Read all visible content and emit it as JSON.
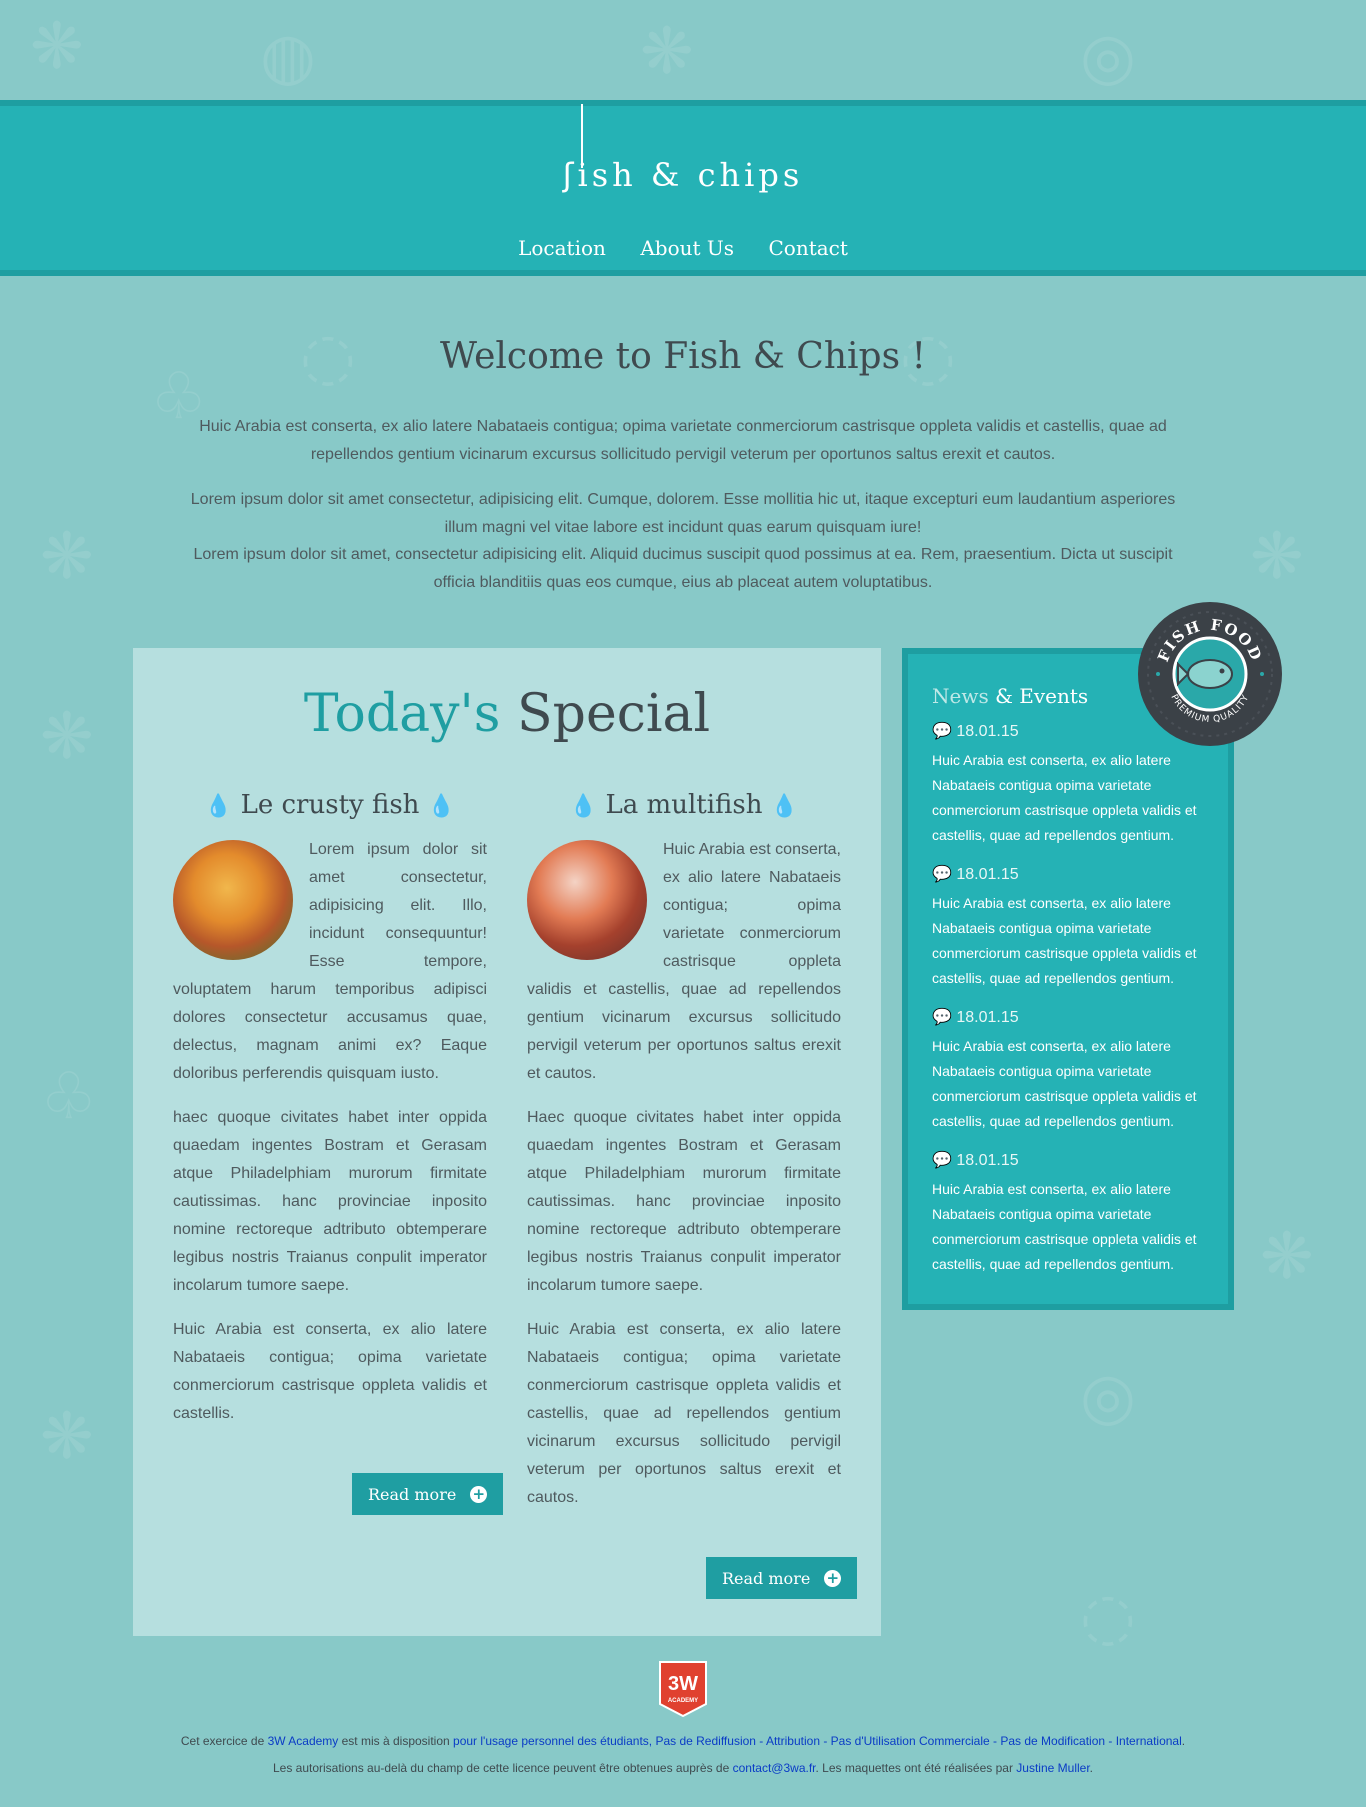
{
  "header": {
    "logo": "ish & chips",
    "nav": [
      "Location",
      "About Us",
      "Contact"
    ]
  },
  "welcome": {
    "title": "Welcome to Fish & Chips !",
    "para1": "Huic Arabia est conserta, ex alio latere Nabataeis contigua; opima varietate conmerciorum castrisque oppleta validis et castellis, quae ad repellendos gentium vicinarum excursus sollicitudo pervigil veterum per oportunos saltus erexit et cautos.",
    "para2": "Lorem ipsum dolor sit amet consectetur, adipisicing elit. Cumque, dolorem. Esse mollitia hic ut, itaque excepturi eum laudantium asperiores illum magni vel vitae labore est incidunt quas earum quisquam iure!",
    "para3": "Lorem ipsum dolor sit amet, consectetur adipisicing elit. Aliquid ducimus suscipit quod possimus at ea. Rem, praesentium. Dicta ut suscipit officia blanditiis quas eos cumque, eius ab placeat autem voluptatibus."
  },
  "special": {
    "title_accent": "Today's",
    "title_rest": "Special",
    "dishes": [
      {
        "name": "Le crusty fish",
        "p1": "Lorem ipsum dolor sit amet consectetur, adipisicing elit. Illo, incidunt consequuntur! Esse tempore, voluptatem harum temporibus adipisci dolores consectetur accusamus quae, delectus, magnam animi ex? Eaque doloribus perferendis quisquam iusto.",
        "p2": "haec quoque civitates habet inter oppida quaedam ingentes Bostram et Gerasam atque Philadelphiam murorum firmitate cautissimas. hanc provinciae inposito nomine rectoreque adtributo obtemperare legibus nostris Traianus conpulit imperator incolarum tumore saepe.",
        "p3": "Huic Arabia est conserta, ex alio latere Nabataeis contigua; opima varietate conmerciorum castrisque oppleta validis et castellis.",
        "button": "Read more"
      },
      {
        "name": "La multifish",
        "p1": "Huic Arabia est conserta, ex alio latere Nabataeis contigua; opima varietate conmerciorum castrisque oppleta validis et castellis, quae ad repellendos gentium vicinarum excursus sollicitudo pervigil veterum per oportunos saltus erexit et cautos.",
        "p2": "Haec quoque civitates habet inter oppida quaedam ingentes Bostram et Gerasam atque Philadelphiam murorum firmitate cautissimas. hanc provinciae inposito nomine rectoreque adtributo obtemperare legibus nostris Traianus conpulit imperator incolarum tumore saepe.",
        "p3": "Huic Arabia est conserta, ex alio latere Nabataeis contigua; opima varietate conmerciorum castrisque oppleta validis et castellis, quae ad repellendos gentium vicinarum excursus sollicitudo pervigil veterum per oportunos saltus erexit et cautos.",
        "button": "Read more"
      }
    ]
  },
  "news": {
    "title_light": "News",
    "title_white": "& Events",
    "items": [
      {
        "date": "18.01.15",
        "text": "Huic Arabia est conserta, ex alio latere Nabataeis contigua opima varietate conmerciorum castrisque oppleta validis et castellis, quae ad repellendos gentium."
      },
      {
        "date": "18.01.15",
        "text": "Huic Arabia est conserta, ex alio latere Nabataeis contigua opima varietate conmerciorum castrisque oppleta validis et castellis, quae ad repellendos gentium."
      },
      {
        "date": "18.01.15",
        "text": "Huic Arabia est conserta, ex alio latere Nabataeis contigua opima varietate conmerciorum castrisque oppleta validis et castellis, quae ad repellendos gentium."
      },
      {
        "date": "18.01.15",
        "text": "Huic Arabia est conserta, ex alio latere Nabataeis contigua opima varietate conmerciorum castrisque oppleta validis et castellis, quae ad repellendos gentium."
      }
    ]
  },
  "badge": {
    "top_text": "FISH FOOD",
    "bottom_text": "PREMIUM QUALITY"
  },
  "footer": {
    "logo_main": "3W",
    "logo_sub": "ACADEMY",
    "l1_a": "Cet exercice de ",
    "l1_link1": "3W Academy",
    "l1_b": " est mis à disposition ",
    "l1_link2": "pour l'usage personnel des étudiants, Pas de Rediffusion - Attribution - Pas d'Utilisation Commerciale - Pas de Modification - International",
    "l1_c": ".",
    "l2_a": "Les autorisations au-delà du champ de cette licence peuvent être obtenues auprès de ",
    "l2_link1": "contact@3wa.fr",
    "l2_b": ". Les maquettes ont été réalisées par ",
    "l2_link2": "Justine Muller",
    "l2_c": "."
  },
  "colors": {
    "background": "#88c9c8",
    "header": "#25b2b5",
    "accent": "#1f9ea2",
    "special_bg": "#b6dfdf",
    "link": "#0b3cc6"
  }
}
